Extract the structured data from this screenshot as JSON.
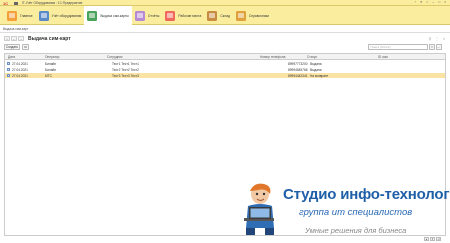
{
  "titlebar": {
    "logo": "1С",
    "app_title": "IT-Учёт Оборудования : 1С:Предприятие"
  },
  "sections": [
    {
      "label": "Главное",
      "icon": "home-icon"
    },
    {
      "label": "Учёт оборудования",
      "icon": "equipment-icon"
    },
    {
      "label": "Выдача сим-карты",
      "icon": "sim-card-icon"
    },
    {
      "label": "Отчёты",
      "icon": "report-icon"
    },
    {
      "label": "Рабочие места",
      "icon": "workplace-icon"
    },
    {
      "label": "Склад",
      "icon": "warehouse-icon"
    },
    {
      "label": "Справочники",
      "icon": "books-icon"
    }
  ],
  "form_tab": {
    "label": "Выдача сим-карт"
  },
  "form": {
    "title": "Выдача сим-карт",
    "create_label": "Создать",
    "search_placeholder": "Поиск (Ctrl+F)"
  },
  "table": {
    "columns": [
      "Дата",
      "Оператор",
      "Сотрудник",
      "Номер телефона",
      "Статус",
      "ID сим"
    ],
    "rows": [
      {
        "date": "27.04.2021",
        "operator": "Билайн",
        "employee": "Тест1 Тест1 Тест1",
        "phone": "89997773200",
        "status": "Выдана",
        "sim": "",
        "selected": false
      },
      {
        "date": "27.04.2021",
        "operator": "Билайн",
        "employee": "Тест2 Тест2 Тест2",
        "phone": "89994545766",
        "status": "Выдана",
        "sim": "",
        "selected": false
      },
      {
        "date": "27.04.2021",
        "operator": "МТС",
        "employee": "Тест3 Тест3 Тест3",
        "phone": "89994442341",
        "status": "На возврате",
        "sim": "",
        "selected": true
      }
    ]
  },
  "watermark": {
    "title": "Студио инфо-технологии",
    "subtitle": "группа ит специалистов",
    "slogan": "Умные решения для бизнеса"
  }
}
